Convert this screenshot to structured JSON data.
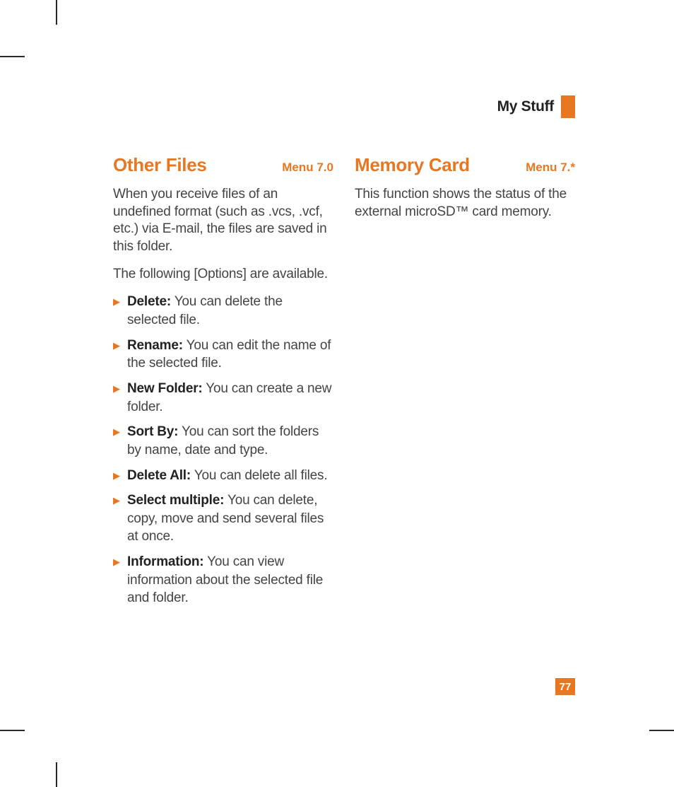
{
  "header": {
    "title": "My Stuff"
  },
  "left": {
    "title": "Other Files",
    "menu": "Menu 7.0",
    "intro": "When you receive files of an undefined format (such as .vcs, .vcf, etc.) via E-mail, the files are saved in this folder.",
    "options_intro": "The following [Options] are available.",
    "options": [
      {
        "label": "Delete:",
        "desc": " You can delete the selected file."
      },
      {
        "label": "Rename:",
        "desc": " You can edit the name of the selected file."
      },
      {
        "label": "New Folder:",
        "desc": " You can create a new folder."
      },
      {
        "label": "Sort By:",
        "desc": " You can sort the folders by name, date and type."
      },
      {
        "label": "Delete All:",
        "desc": " You can delete all files."
      },
      {
        "label": "Select multiple:",
        "desc": " You can delete, copy, move and send several files at once."
      },
      {
        "label": "Information:",
        "desc": " You can view information about the selected file and folder."
      }
    ]
  },
  "right": {
    "title": "Memory Card",
    "menu": "Menu 7.*",
    "intro": "This function shows the status of the external microSD™ card memory."
  },
  "page_number": "77"
}
